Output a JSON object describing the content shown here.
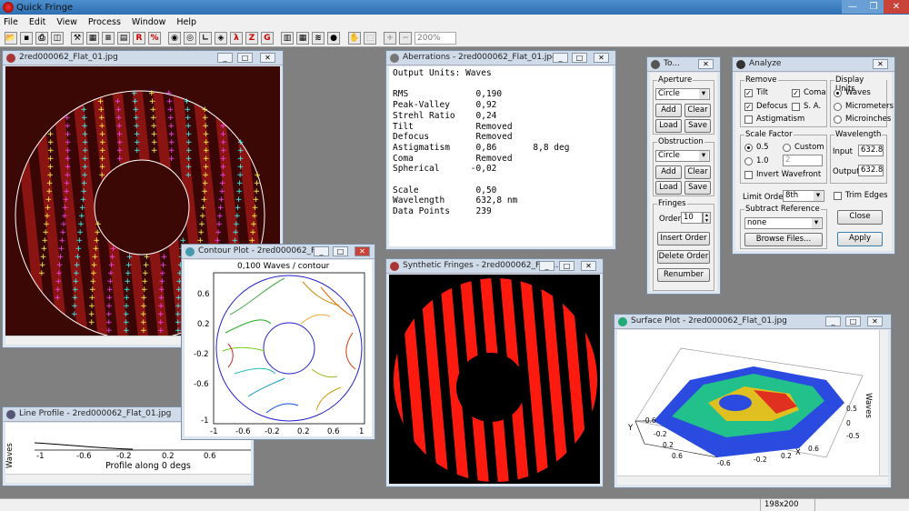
{
  "app": {
    "title": "Quick Fringe"
  },
  "menu": [
    "File",
    "Edit",
    "View",
    "Process",
    "Window",
    "Help"
  ],
  "toolbar": {
    "zoom": "200%"
  },
  "igram": {
    "title": "2red000062_Flat_01.jpg"
  },
  "aberr": {
    "title": "Aberrations - 2red000062_Flat_01.jpg",
    "lines": [
      "Output Units: Waves",
      "",
      "RMS             0,190",
      "Peak-Valley     0,92",
      "Strehl Ratio    0,24",
      "Tilt            Removed",
      "Defocus         Removed",
      "Astigmatism     0,86       8,8 deg",
      "Coma            Removed",
      "Spherical      -0,02",
      "",
      "Scale           0,50",
      "Wavelength      632,8 nm",
      "Data Points     239"
    ]
  },
  "contour": {
    "title": "Contour Plot - 2red000062_F...",
    "header": "0,100 Waves / contour",
    "yticks": [
      "0.6",
      "0.2",
      "-0.2",
      "-0.6",
      "-1"
    ],
    "xticks": [
      "-1",
      "-0.6",
      "-0.2",
      "0.2",
      "0.6",
      "1"
    ]
  },
  "lineprofile": {
    "title": "Line Profile - 2red000062_Flat_01.jpg",
    "ylabel": "Waves",
    "xticks": [
      "-1",
      "-0.6",
      "-0.2",
      "0.2",
      "0.6"
    ],
    "xlabel": "Profile along 0 degs"
  },
  "synthetic": {
    "title": "Synthetic Fringes - 2red000062_Flat..."
  },
  "surface": {
    "title": "Surface Plot - 2red000062_Flat_01.jpg",
    "x_axis": "X",
    "y_axis": "Y",
    "z_axis": "Waves",
    "ticks": [
      "-0.6",
      "-0.2",
      "0.2",
      "0.6",
      "-0.6",
      "-0.2",
      "0.2",
      "0.6",
      "0.5",
      "0",
      "-0.5"
    ]
  },
  "tools": {
    "title": "To...",
    "aperture_label": "Aperture",
    "aperture_value": "Circle",
    "add": "Add",
    "clear": "Clear",
    "load": "Load",
    "save": "Save",
    "obstruction_label": "Obstruction",
    "obstruction_value": "Circle",
    "fringes_label": "Fringes",
    "order_label": "Order",
    "order_value": "10",
    "insert_order": "Insert Order",
    "delete_order": "Delete Order",
    "renumber": "Renumber"
  },
  "analyze": {
    "title": "Analyze",
    "remove_label": "Remove",
    "tilt": "Tilt",
    "coma": "Coma",
    "defocus": "Defocus",
    "sa": "S. A.",
    "astig": "Astigmatism",
    "display_units_label": "Display Units",
    "waves": "Waves",
    "micrometers": "Micrometers",
    "microinches": "Microinches",
    "scale_factor_label": "Scale Factor",
    "sf05": "0.5",
    "custom": "Custom",
    "sf10": "1.0",
    "custom_value": "2",
    "invert": "Invert Wavefront",
    "wavelength_label": "Wavelength",
    "input_label": "Input",
    "input_value": "632.8",
    "output_label": "Output",
    "output_value": "632.8",
    "limit_order_label": "Limit Order",
    "limit_order_value": "8th",
    "trim_edges": "Trim Edges",
    "subtract_label": "Subtract Reference",
    "subtract_value": "none",
    "browse": "Browse Files...",
    "close": "Close",
    "apply": "Apply"
  },
  "status": {
    "dims": "198x200"
  }
}
